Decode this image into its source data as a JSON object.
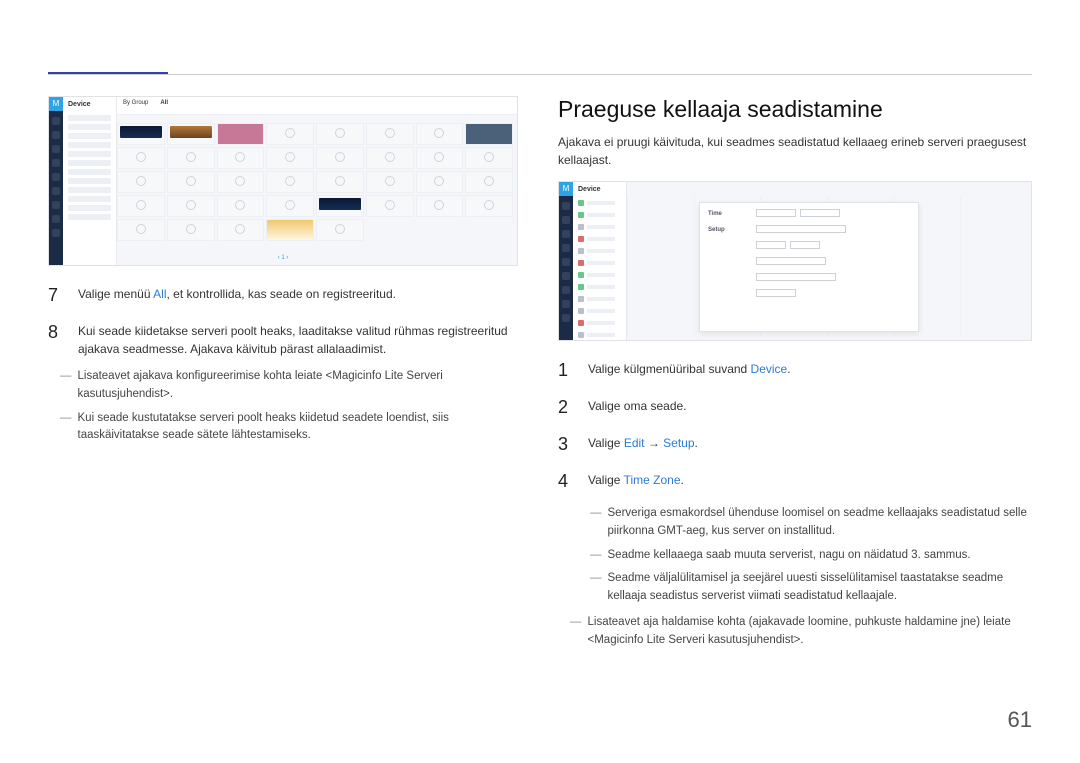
{
  "page_number": "61",
  "left": {
    "screenshot": {
      "side_label": "M",
      "panel_title": "Device",
      "top_labels": [
        "By Group",
        "All"
      ]
    },
    "steps": [
      {
        "num": "7",
        "text_pre": "Valige menüü ",
        "link": "All",
        "text_post": ", et kontrollida, kas seade on registreeritud."
      },
      {
        "num": "8",
        "text": "Kui seade kiidetakse serveri poolt heaks, laaditakse valitud rühmas registreeritud ajakava seadmesse. Ajakava käivitub pärast allalaadimist."
      }
    ],
    "notes": [
      "Lisateavet ajakava konfigureerimise kohta leiate <Magicinfo Lite Serveri kasutusjuhendist>.",
      "Kui seade kustutatakse serveri poolt heaks kiidetud seadete loendist, siis taaskäivitatakse seade sätete lähtestamiseks."
    ]
  },
  "right": {
    "heading": "Praeguse kellaaja seadistamine",
    "intro": "Ajakava ei pruugi käivituda, kui seadmes seadistatud kellaaeg erineb serveri praegusest kellaajast.",
    "screenshot": {
      "side_label": "M",
      "panel_title": "Device",
      "modal_rows": [
        "Time",
        "Setup"
      ]
    },
    "steps": [
      {
        "num": "1",
        "text_pre": "Valige külgmenüüribal suvand ",
        "link": "Device",
        "text_post": "."
      },
      {
        "num": "2",
        "text": "Valige oma seade."
      },
      {
        "num": "3",
        "text_pre": "Valige ",
        "link": "Edit",
        "arrow": " → ",
        "link2": "Setup",
        "text_post": "."
      },
      {
        "num": "4",
        "text_pre": "Valige ",
        "link": "Time Zone",
        "text_post": "."
      }
    ],
    "subnotes": [
      "Serveriga esmakordsel ühenduse loomisel on seadme kellaajaks seadistatud selle piirkonna GMT-aeg, kus server on installitud.",
      "Seadme kellaaega saab muuta serverist, nagu on näidatud 3. sammus.",
      "Seadme väljalülitamisel ja seejärel uuesti sisselülitamisel taastatakse seadme kellaaja seadistus serverist viimati seadistatud kellaajale."
    ],
    "finalnote": "Lisateavet aja haldamise kohta (ajakavade loomine, puhkuste haldamine jne) leiate <Magicinfo Lite Serveri kasutusjuhendist>."
  }
}
